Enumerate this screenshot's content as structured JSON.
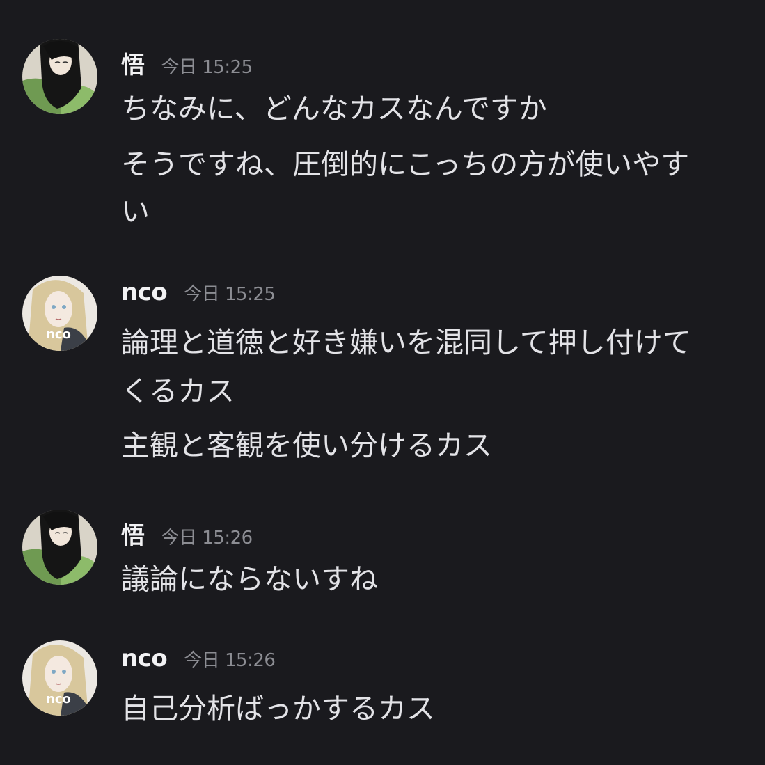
{
  "messages": [
    {
      "author": "悟",
      "avatar_icon": "user-avatar-goku",
      "timestamp": "今日 15:25",
      "lines": [
        "ちなみに、どんなカスなんですか",
        "そうですね、圧倒的にこっちの方が使いやす",
        "い"
      ]
    },
    {
      "author": "nco",
      "avatar_icon": "user-avatar-nco",
      "avatar_text": "nco",
      "timestamp": "今日 15:25",
      "lines": [
        "論理と道徳と好き嫌いを混同して押し付けて",
        "くるカス",
        "主観と客観を使い分けるカス"
      ]
    },
    {
      "author": "悟",
      "avatar_icon": "user-avatar-goku",
      "timestamp": "今日 15:26",
      "lines": [
        "議論にならないすね"
      ]
    },
    {
      "author": "nco",
      "avatar_icon": "user-avatar-nco",
      "avatar_text": "nco",
      "timestamp": "今日 15:26",
      "lines": [
        "自己分析ばっかするカス"
      ]
    }
  ],
  "colors": {
    "background": "#1a1a1e",
    "username": "#f2f2f4",
    "timestamp": "#8c8d93",
    "message_text": "#e3e3e7"
  }
}
